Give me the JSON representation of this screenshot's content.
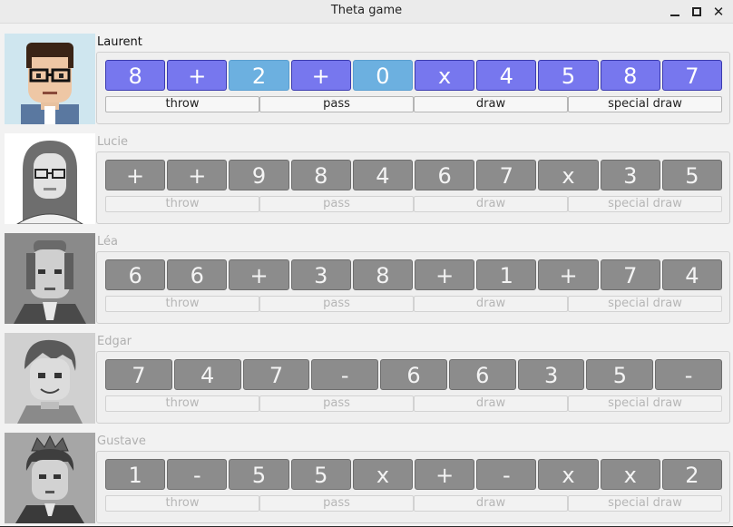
{
  "window": {
    "title": "Theta game",
    "minimize_glyph": "",
    "maximize_glyph": "",
    "close_glyph": "✕"
  },
  "colors": {
    "tile_active": "#7777ee",
    "tile_selected": "#6cb0e0",
    "tile_inactive": "#8c8c8c"
  },
  "action_labels": [
    "throw",
    "pass",
    "draw",
    "special draw"
  ],
  "players": [
    {
      "name": "Laurent",
      "active": true,
      "avatar": "man-glasses-avatar",
      "tiles": [
        "8",
        "+",
        "2",
        "+",
        "0",
        "x",
        "4",
        "5",
        "8",
        "7"
      ],
      "selected": [
        2,
        4
      ]
    },
    {
      "name": "Lucie",
      "active": false,
      "avatar": "woman-glasses-avatar",
      "tiles": [
        "+",
        "+",
        "9",
        "8",
        "4",
        "6",
        "7",
        "x",
        "3",
        "5"
      ],
      "selected": []
    },
    {
      "name": "Léa",
      "active": false,
      "avatar": "woman-uniform-avatar",
      "tiles": [
        "6",
        "6",
        "+",
        "3",
        "8",
        "+",
        "1",
        "+",
        "7",
        "4"
      ],
      "selected": []
    },
    {
      "name": "Edgar",
      "active": false,
      "avatar": "boy-avatar",
      "tiles": [
        "7",
        "4",
        "7",
        "-",
        "6",
        "6",
        "3",
        "5",
        "-"
      ],
      "selected": []
    },
    {
      "name": "Gustave",
      "active": false,
      "avatar": "boy-crown-avatar",
      "tiles": [
        "1",
        "-",
        "5",
        "5",
        "x",
        "+",
        "-",
        "x",
        "x",
        "2"
      ],
      "selected": []
    }
  ]
}
